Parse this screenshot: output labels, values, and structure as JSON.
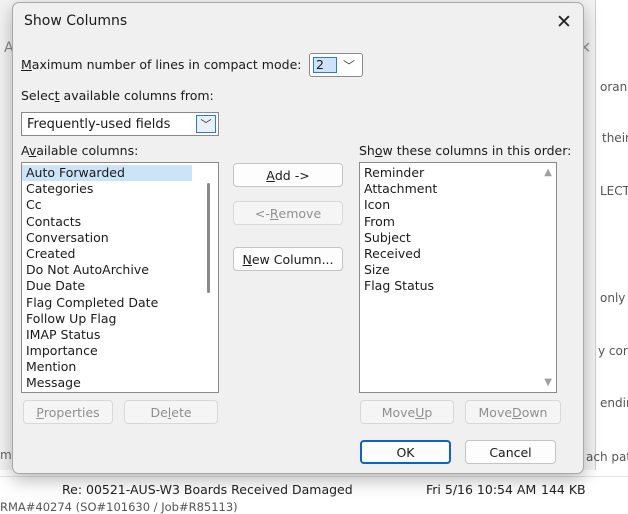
{
  "background": {
    "frag_top": "orang",
    "frag_their": "their",
    "frag_lect": "LECT",
    "frag_only": "only",
    "frag_cor": "y cor",
    "frag_endi": "endin",
    "frag_ach": "ach patl",
    "left_letter": "A",
    "left_m": "m",
    "mail_subject": "Re: 00521-AUS-W3 Boards Received Damaged",
    "mail_date": "Fri 5/16 10:54 AM",
    "mail_size": "144 KB",
    "mail_sub2": "RMA#40274 (SO#101630 / Job#R85113)"
  },
  "dialog": {
    "title": "Show Columns",
    "max_lines_label_u": "M",
    "max_lines_label_rest": "aximum number of lines in compact mode:",
    "max_lines_value": "2",
    "select_from_label_pre": "Selec",
    "select_from_label_u": "t",
    "select_from_label_post": " available columns from:",
    "fields_value": "Frequently-used fields",
    "available_label_pre": "A",
    "available_label_u": "v",
    "available_label_post": "ailable columns:",
    "show_label_pre": "Sh",
    "show_label_u": "o",
    "show_label_post": "w these columns in this order:",
    "available_columns": [
      "Auto Forwarded",
      "Categories",
      "Cc",
      "Contacts",
      "Conversation",
      "Created",
      "Do Not AutoArchive",
      "Due Date",
      "Flag Completed Date",
      "Follow Up Flag",
      "IMAP Status",
      "Importance",
      "Mention",
      "Message"
    ],
    "shown_columns": [
      "Reminder",
      "Attachment",
      "Icon",
      "From",
      "Subject",
      "Received",
      "Size",
      "Flag Status"
    ],
    "add_u": "A",
    "add_rest": "dd ->",
    "remove_pre": "<- ",
    "remove_u": "R",
    "remove_rest": "emove",
    "new_col_u": "N",
    "new_col_rest": "ew Column...",
    "properties_u": "P",
    "properties_rest": "roperties",
    "delete_pre": "De",
    "delete_u": "l",
    "delete_rest": "ete",
    "move_up_pre": "Move ",
    "move_up_u": "U",
    "move_up_rest": "p",
    "move_down_pre": "Move ",
    "move_down_u": "D",
    "move_down_rest": "own",
    "ok_label": "OK",
    "cancel_label": "Cancel"
  }
}
